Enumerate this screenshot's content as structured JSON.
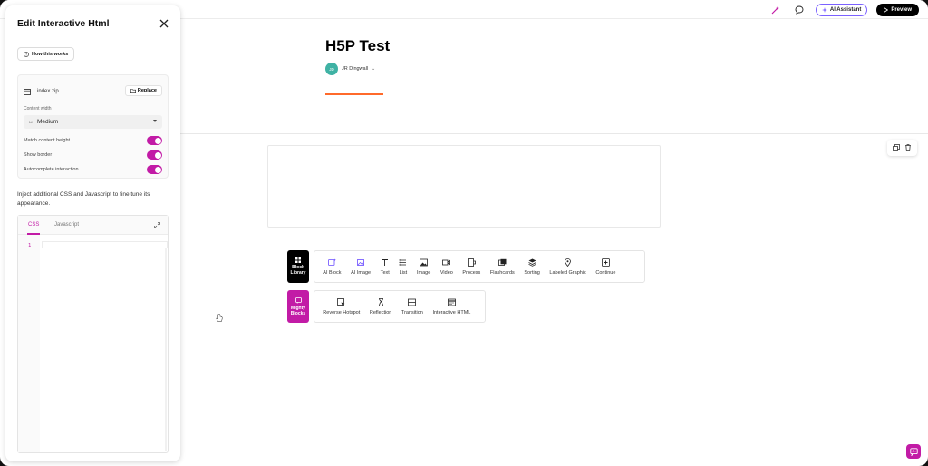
{
  "topbar": {
    "ai_assistant_label": "AI Assistant",
    "preview_label": "Preview"
  },
  "panel": {
    "title": "Edit Interactive Html",
    "how_label": "How this works",
    "file_name": "index.zip",
    "replace_label": "Replace",
    "content_width_label": "Content width",
    "content_width_value": "Medium",
    "toggles": [
      {
        "label": "Match content height",
        "on": true
      },
      {
        "label": "Show border",
        "on": true
      },
      {
        "label": "Autocomplete interaction",
        "on": true
      }
    ],
    "inject_text": "Inject additional CSS and Javascript to fine tune its appearance.",
    "tabs": [
      "CSS",
      "Javascript"
    ],
    "active_tab": "CSS",
    "line_number": "1"
  },
  "main": {
    "title": "H5P Test",
    "author_initials": "JD",
    "author_name": "JR Dingwall",
    "block_library_label_1": "Block",
    "block_library_label_2": "Library",
    "mighty_label_1": "Mighty",
    "mighty_label_2": "Blocks",
    "tools_row1": [
      "AI Block",
      "AI Image",
      "Text",
      "List",
      "Image",
      "Video",
      "Process",
      "Flashcards",
      "Sorting",
      "Labeled Graphic",
      "Continue"
    ],
    "tools_row2": [
      "Reverse Hotspot",
      "Reflection",
      "Transition",
      "Interactive HTML"
    ]
  },
  "colors": {
    "accent": "#c21ba6",
    "underline": "#ff6a2b",
    "ai_border": "#7b61ff"
  }
}
